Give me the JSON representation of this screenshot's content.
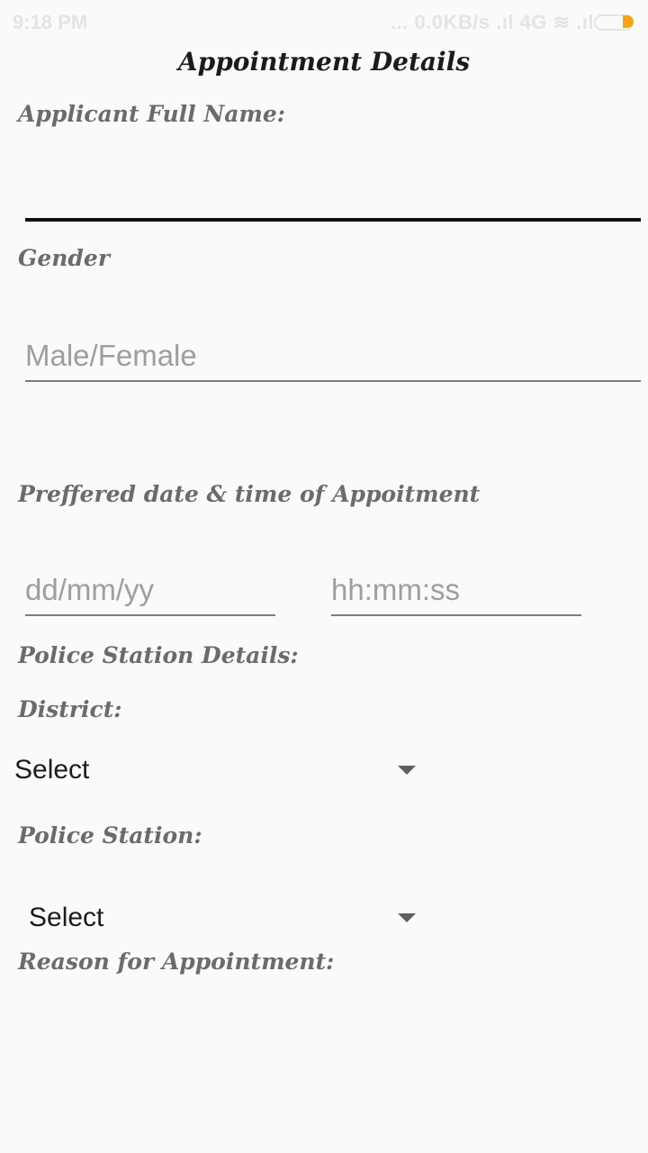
{
  "status_bar": {
    "time": "9:18 PM",
    "right_text": "... 0.0KB/s .ıl 4G ≋ .ıl",
    "battery_level": "7",
    "battery_accent": "#f3a51a"
  },
  "page": {
    "title": "Appointment Details"
  },
  "form": {
    "full_name_label": "Applicant Full Name:",
    "full_name_value": "",
    "gender_label": "Gender",
    "gender_placeholder": "Male/Female",
    "date_time_label": "Preffered date & time of Appoitment",
    "date_placeholder": "dd/mm/yy",
    "time_placeholder": "hh:mm:ss",
    "police_station_details_label": "Police Station Details:",
    "district_label": "District:",
    "district_select": "Select",
    "police_station_label": "Police Station:",
    "police_station_select": "Select",
    "reason_label": "Reason for Appointment:"
  },
  "icons": {
    "dropdown": "chevron-down-icon"
  }
}
